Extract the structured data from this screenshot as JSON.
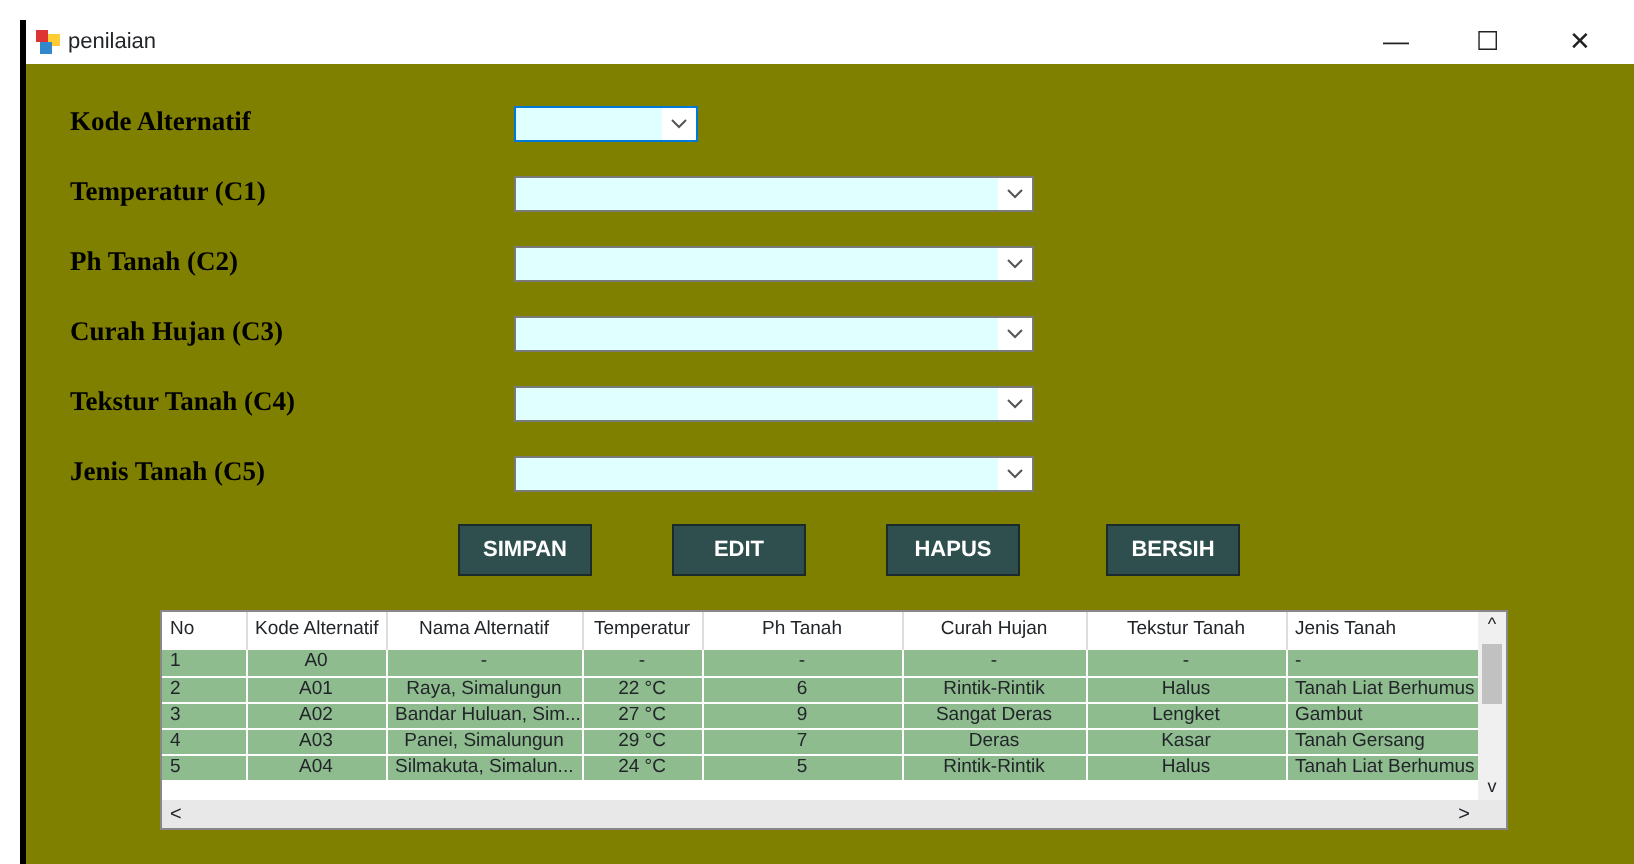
{
  "window": {
    "title": "penilaian",
    "controls": [
      "—",
      "☐",
      "✕"
    ]
  },
  "fields": [
    {
      "label": "Kode Alternatif",
      "kind": "short"
    },
    {
      "label": "Temperatur (C1)",
      "kind": "long"
    },
    {
      "label": "Ph Tanah (C2)",
      "kind": "long"
    },
    {
      "label": "Curah Hujan (C3)",
      "kind": "long"
    },
    {
      "label": "Tekstur Tanah (C4)",
      "kind": "long"
    },
    {
      "label": "Jenis Tanah (C5)",
      "kind": "long"
    }
  ],
  "buttons": [
    "SIMPAN",
    "EDIT",
    "HAPUS",
    "BERSIH"
  ],
  "table": {
    "columns": [
      "No",
      "Kode Alternatif",
      "Nama Alternatif",
      "Temperatur",
      "Ph Tanah",
      "Curah Hujan",
      "Tekstur Tanah",
      "Jenis Tanah"
    ],
    "rows": [
      [
        "1",
        "A0",
        "-",
        "-",
        "-",
        "-",
        "-",
        "-"
      ],
      [
        "2",
        "A01",
        "Raya, Simalungun",
        "22 °C",
        "6",
        "Rintik-Rintik",
        "Halus",
        "Tanah Liat Berhumus"
      ],
      [
        "3",
        "A02",
        "Bandar Huluan, Sim...",
        "27 °C",
        "9",
        "Sangat Deras",
        "Lengket",
        "Gambut"
      ],
      [
        "4",
        "A03",
        "Panei, Simalungun",
        "29 °C",
        "7",
        "Deras",
        "Kasar",
        "Tanah Gersang"
      ],
      [
        "5",
        "A04",
        "Silmakuta, Simalun...",
        "24 °C",
        "5",
        "Rintik-Rintik",
        "Halus",
        "Tanah Liat Berhumus"
      ]
    ],
    "scroll_arrows": {
      "up": "^",
      "down": "v",
      "left": "<",
      "right": ">"
    }
  }
}
